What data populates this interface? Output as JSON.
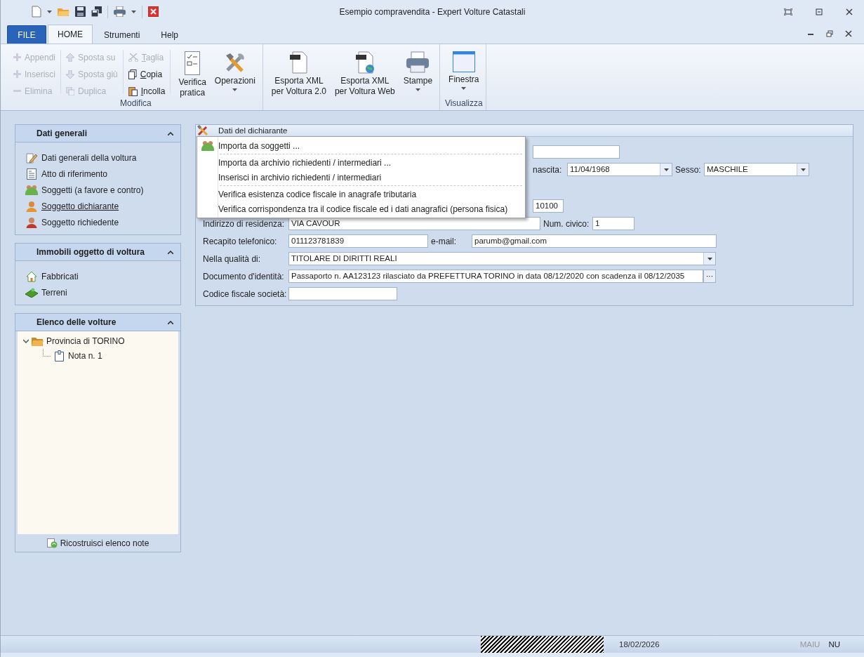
{
  "window": {
    "title": "Esempio compravendita - Expert Volture Catastali"
  },
  "tabs": [
    {
      "label": "FILE",
      "kind": "file",
      "selected": false
    },
    {
      "label": "HOME",
      "kind": "tab",
      "selected": true
    },
    {
      "label": "Strumenti",
      "kind": "tab",
      "selected": false
    },
    {
      "label": "Help",
      "kind": "tab",
      "selected": false
    }
  ],
  "ribbon": {
    "groups": [
      {
        "label": "Modifica",
        "columns": [
          [
            {
              "label": "Appendi",
              "disabled": true,
              "mnemonic": false
            },
            {
              "label": "Inserisci",
              "disabled": true,
              "mnemonic": false
            },
            {
              "label": "Elimina",
              "disabled": true,
              "mnemonic": false
            }
          ],
          [
            {
              "label": "Sposta su",
              "disabled": true,
              "mnemonic": false
            },
            {
              "label": "Sposta giù",
              "disabled": true,
              "mnemonic": false
            },
            {
              "label": "Duplica",
              "disabled": true,
              "mnemonic": false
            }
          ],
          [
            {
              "label": "Taglia",
              "disabled": true,
              "mnemonic": true
            },
            {
              "label": "Copia",
              "disabled": false,
              "mnemonic": true
            },
            {
              "label": "Incolla",
              "disabled": false,
              "mnemonic": true
            }
          ]
        ],
        "large": [
          {
            "lines": [
              "Verifica",
              "pratica"
            ],
            "dropdown": false
          },
          {
            "lines": [
              "Operazioni"
            ],
            "dropdown": true
          }
        ]
      },
      {
        "large": [
          {
            "lines": [
              "Esporta XML",
              "per Voltura 2.0"
            ],
            "dropdown": false
          },
          {
            "lines": [
              "Esporta XML",
              "per Voltura Web"
            ],
            "dropdown": false
          },
          {
            "lines": [
              "Stampe"
            ],
            "dropdown": true
          }
        ]
      },
      {
        "label": "Visualizza",
        "large": [
          {
            "lines": [
              "Finestra"
            ],
            "dropdown": true
          }
        ]
      }
    ]
  },
  "sidebar": {
    "panels": [
      {
        "title": "Dati generali",
        "kind": "list",
        "items": [
          {
            "label": "Dati generali della voltura",
            "selected": false
          },
          {
            "label": "Atto di riferimento",
            "selected": false
          },
          {
            "label": "Soggetti (a favore e contro)",
            "selected": false
          },
          {
            "label": "Soggetto dichiarante",
            "selected": true
          },
          {
            "label": "Soggetto richiedente",
            "selected": false
          }
        ]
      },
      {
        "title": "Immobili oggetto di voltura",
        "kind": "list",
        "items": [
          {
            "label": "Fabbricati",
            "selected": false
          },
          {
            "label": "Terreni",
            "selected": false
          }
        ]
      },
      {
        "title": "Elenco delle volture",
        "kind": "tree",
        "tree": [
          {
            "label": "Provincia di TORINO",
            "expanded": true,
            "children": [
              {
                "label": "Nota n. 1"
              }
            ]
          }
        ],
        "footer_button": "Ricostruisci elenco note"
      }
    ]
  },
  "form": {
    "title": "Dati del dichiarante",
    "rows": [
      {
        "covered": true,
        "items": [
          {
            "kind": "text"
          }
        ]
      },
      {
        "covered": true,
        "items": [
          {
            "kind": "label",
            "text": "nascita:"
          },
          {
            "kind": "combo",
            "value": "11/04/1968"
          },
          {
            "kind": "label",
            "text": "Sesso:"
          },
          {
            "kind": "combo",
            "value": "MASCHILE"
          }
        ]
      },
      {
        "covered": true,
        "items": [
          {
            "kind": "text",
            "value": "10100"
          }
        ]
      },
      {
        "covered": false,
        "items": [
          {
            "kind": "label",
            "text": "Indirizzo di residenza:"
          },
          {
            "kind": "text",
            "value": "VIA CAVOUR"
          },
          {
            "kind": "label",
            "text": "Num. civico:"
          },
          {
            "kind": "text",
            "value": "1"
          }
        ]
      },
      {
        "covered": false,
        "items": [
          {
            "kind": "label",
            "text": "Recapito telefonico:"
          },
          {
            "kind": "text",
            "value": "011123781839"
          },
          {
            "kind": "label",
            "text": "e-mail:"
          },
          {
            "kind": "text",
            "value": "parumb@gmail.com"
          }
        ]
      },
      {
        "covered": false,
        "items": [
          {
            "kind": "label",
            "text": "Nella qualità di:"
          },
          {
            "kind": "combo",
            "value": "TITOLARE DI DIRITTI REALI"
          }
        ]
      },
      {
        "covered": false,
        "items": [
          {
            "kind": "label",
            "text": "Documento d'identità:"
          },
          {
            "kind": "browse",
            "value": "Passaporto n. AA123123 rilasciato da PREFETTURA TORINO in data 08/12/2020 con scadenza il 08/12/2035",
            "button": "···"
          }
        ]
      },
      {
        "covered": false,
        "items": [
          {
            "kind": "label",
            "text": "Codice fiscale società:"
          },
          {
            "kind": "text"
          }
        ]
      }
    ]
  },
  "context_menu": {
    "items": [
      {
        "label": "Importa da soggetti ...",
        "separator_after": true
      },
      {
        "label": "Importa da archivio richiedenti / intermediari ...",
        "separator_after": false
      },
      {
        "label": "Inserisci in archivio richiedenti / intermediari",
        "separator_after": true
      },
      {
        "label": "Verifica esistenza codice fiscale in anagrafe tributaria",
        "separator_after": false
      },
      {
        "label": "Verifica corrispondenza tra il codice fiscale ed i dati anagrafici (persona fisica)",
        "separator_after": false
      }
    ]
  },
  "status_bar": {
    "date": "18/02/2026",
    "indicators": [
      {
        "label": "MAIU",
        "on": false
      },
      {
        "label": "NU",
        "on": true
      }
    ]
  }
}
